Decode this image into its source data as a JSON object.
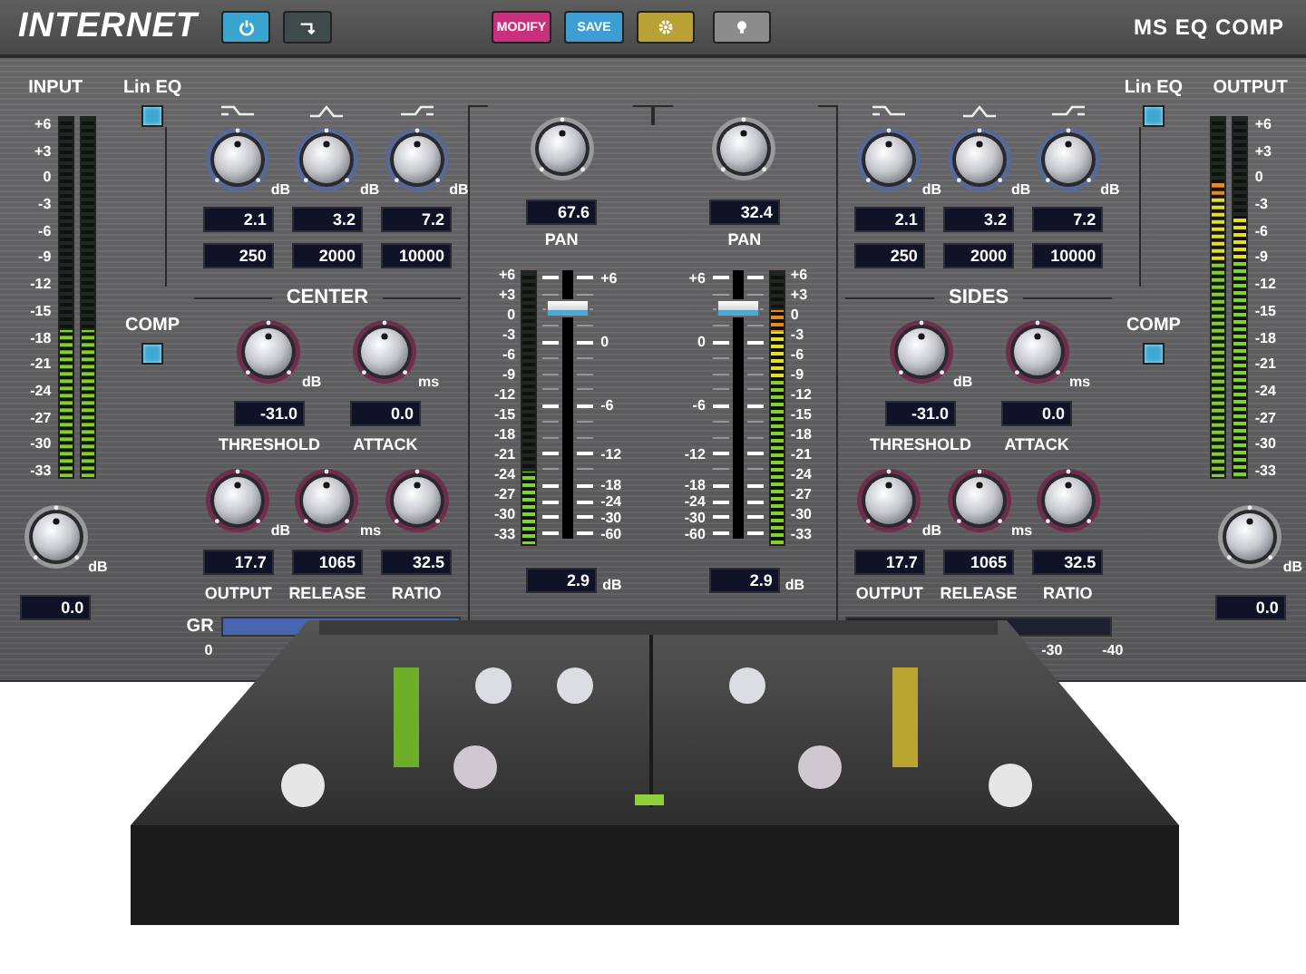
{
  "header": {
    "logo": "INTERNET",
    "buttons": [
      {
        "kind": "power",
        "on": true
      },
      {
        "kind": "route",
        "on": false
      },
      {
        "kind": "text",
        "label": "MODIFY",
        "color": "#c8307e"
      },
      {
        "kind": "text",
        "label": "SAVE",
        "color": "#3c9ed2"
      },
      {
        "kind": "gear",
        "color": "#b9a136"
      },
      {
        "kind": "bulb",
        "color": "#8c8c8c"
      }
    ],
    "title": "MS EQ COMP"
  },
  "channels": [
    {
      "io": {
        "label": "INPUT",
        "scale": [
          "+6",
          "+3",
          "0",
          "-3",
          "-6",
          "-9",
          "-12",
          "-15",
          "-18",
          "-21",
          "-24",
          "-27",
          "-30",
          "-33"
        ],
        "meters": [
          {
            "level": 0.41
          },
          {
            "level": 0.41
          }
        ],
        "knob": {
          "unit": "dB"
        },
        "value": "0.0"
      },
      "lin_eq": {
        "label": "Lin EQ",
        "checked": true
      },
      "eq": [
        {
          "kind": "low_shelf",
          "unit": "dB",
          "gain": "2.1",
          "freq": "250"
        },
        {
          "kind": "bell",
          "unit": "dB",
          "gain": "3.2",
          "freq": "2000"
        },
        {
          "kind": "high_shelf",
          "unit": "dB",
          "gain": "7.2",
          "freq": "10000"
        }
      ],
      "section": "CENTER",
      "comp": {
        "label": "COMP",
        "checked": true,
        "top": [
          {
            "label": "THRESHOLD",
            "unit": "dB",
            "value": "-31.0"
          },
          {
            "label": "ATTACK",
            "unit": "ms",
            "value": "0.0"
          }
        ],
        "bottom": [
          {
            "label": "OUTPUT",
            "unit": "dB",
            "value": "17.7"
          },
          {
            "label": "RELEASE",
            "unit": "ms",
            "value": "1065"
          },
          {
            "label": "RATIO",
            "value": "32.5"
          }
        ]
      },
      "gr": {
        "label": "GR",
        "scale": [
          "0"
        ]
      },
      "pan": {
        "value": "67.6",
        "label": "PAN"
      },
      "fader": {
        "scale": [
          "+6",
          "+3",
          "0",
          "-3",
          "-6",
          "-9",
          "-12",
          "-15",
          "-18",
          "-21",
          "-24",
          "-27",
          "-30",
          "-33"
        ],
        "meter": {
          "level": 0.27
        },
        "marks": [
          "+6",
          "0",
          "-6",
          "-12",
          "-18",
          "-24",
          "-30",
          "-60"
        ],
        "level": 0.86,
        "value": "2.9",
        "unit": "dB"
      }
    },
    {
      "io": {
        "label": "OUTPUT",
        "scale": [
          "+6",
          "+3",
          "0",
          "-3",
          "-6",
          "-9",
          "-12",
          "-15",
          "-18",
          "-21",
          "-24",
          "-27",
          "-30",
          "-33"
        ],
        "meters": [
          {
            "level": 0.82
          },
          {
            "level": 0.72
          }
        ],
        "knob": {
          "unit": "dB"
        },
        "value": "0.0"
      },
      "lin_eq": {
        "label": "Lin EQ",
        "checked": true
      },
      "eq": [
        {
          "kind": "low_shelf",
          "unit": "dB",
          "gain": "2.1",
          "freq": "250"
        },
        {
          "kind": "bell",
          "unit": "dB",
          "gain": "3.2",
          "freq": "2000"
        },
        {
          "kind": "high_shelf",
          "unit": "dB",
          "gain": "7.2",
          "freq": "10000"
        }
      ],
      "section": "SIDES",
      "comp": {
        "label": "COMP",
        "checked": true,
        "top": [
          {
            "label": "THRESHOLD",
            "unit": "dB",
            "value": "-31.0"
          },
          {
            "label": "ATTACK",
            "unit": "ms",
            "value": "0.0"
          }
        ],
        "bottom": [
          {
            "label": "OUTPUT",
            "unit": "dB",
            "value": "17.7"
          },
          {
            "label": "RELEASE",
            "unit": "ms",
            "value": "1065"
          },
          {
            "label": "RATIO",
            "value": "32.5"
          }
        ]
      },
      "gr": {
        "scale": [
          "-30",
          "-40"
        ]
      },
      "pan": {
        "value": "32.4",
        "label": "PAN"
      },
      "fader": {
        "scale": [
          "+6",
          "+3",
          "0",
          "-3",
          "-6",
          "-9",
          "-12",
          "-15",
          "-18",
          "-21",
          "-24",
          "-27",
          "-30",
          "-33"
        ],
        "meter": {
          "level": 0.86
        },
        "marks": [
          "+6",
          "0",
          "-6",
          "-12",
          "-18",
          "-24",
          "-30",
          "-60"
        ],
        "level": 0.86,
        "value": "2.9",
        "unit": "dB"
      }
    }
  ]
}
